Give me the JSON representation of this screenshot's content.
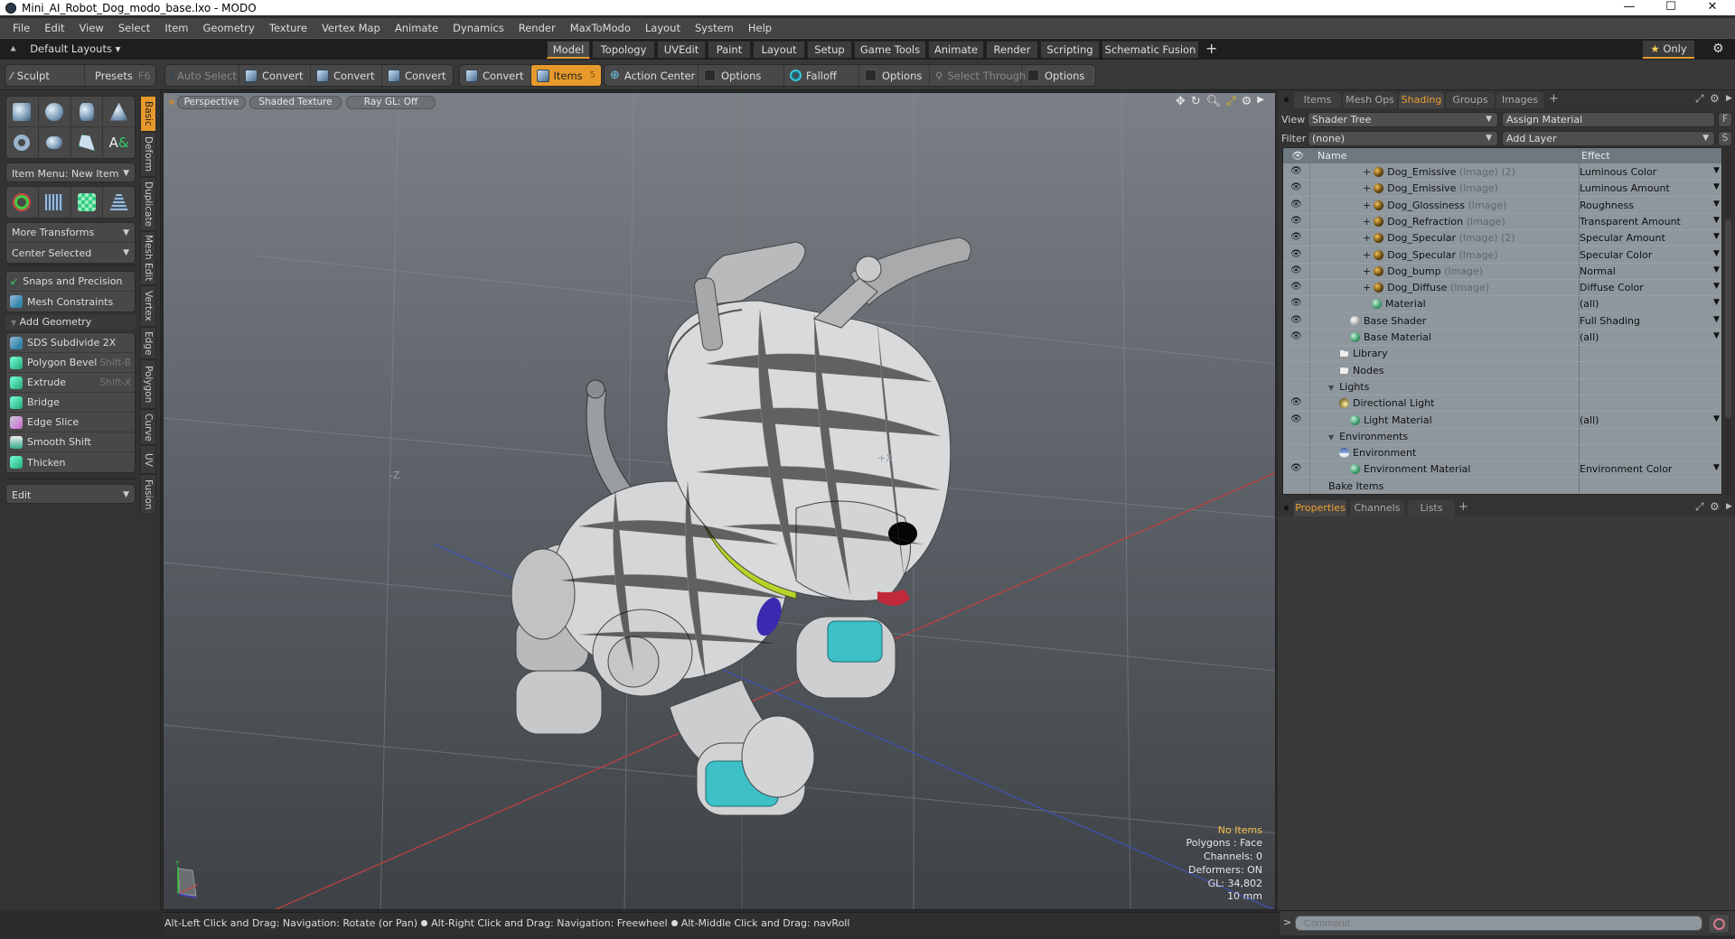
{
  "window": {
    "title": "Mini_AI_Robot_Dog_modo_base.lxo - MODO",
    "controls": {
      "minimize": "—",
      "maximize": "☐",
      "close": "✕"
    }
  },
  "menubar": [
    "File",
    "Edit",
    "View",
    "Select",
    "Item",
    "Geometry",
    "Texture",
    "Vertex Map",
    "Animate",
    "Dynamics",
    "Render",
    "MaxToModo",
    "Layout",
    "System",
    "Help"
  ],
  "layoutbar": {
    "layouts_label": "Default Layouts ▾",
    "tabs": [
      "Model",
      "Topology",
      "UVEdit",
      "Paint",
      "Layout",
      "Setup",
      "Game Tools",
      "Animate",
      "Render",
      "Scripting",
      "Schematic Fusion"
    ],
    "active_tab": "Model",
    "add_tab": "+",
    "only_label": "Only",
    "star": "★"
  },
  "toolbar": {
    "sculpt": "Sculpt",
    "presets": "Presets",
    "presets_shortcut": "F6",
    "auto_select": "Auto Select",
    "convert": "Convert",
    "items": "Items",
    "items_count": "5",
    "action_center": "Action Center",
    "options": "Options",
    "falloff": "Falloff",
    "select_through": "Select Through"
  },
  "leftpanel": {
    "item_menu": "Item Menu: New Item",
    "more_transforms": "More Transforms",
    "center_selected": "Center Selected",
    "snaps": "Snaps and Precision",
    "mesh_constraints": "Mesh Constraints",
    "add_geometry": "Add Geometry",
    "tools": [
      {
        "label": "SDS Subdivide 2X",
        "shortcut": ""
      },
      {
        "label": "Polygon Bevel",
        "shortcut": "Shift-B"
      },
      {
        "label": "Extrude",
        "shortcut": "Shift-X"
      },
      {
        "label": "Bridge",
        "shortcut": ""
      },
      {
        "label": "Edge Slice",
        "shortcut": ""
      },
      {
        "label": "Smooth Shift",
        "shortcut": ""
      },
      {
        "label": "Thicken",
        "shortcut": ""
      }
    ],
    "edit_dropdown": "Edit",
    "vertical_tabs": [
      "Basic",
      "Deform",
      "Duplicate",
      "Mesh Edit",
      "Vertex",
      "Edge",
      "Polygon",
      "Curve",
      "UV",
      "Fusion"
    ],
    "active_vertical_tab": "Basic"
  },
  "viewport": {
    "view": "Perspective",
    "shading": "Shaded Texture",
    "raygl": "Ray GL: Off",
    "hud": {
      "selection": "No Items",
      "polygons": "Polygons : Face",
      "channels": "Channels: 0",
      "deformers": "Deformers: ON",
      "gl": "GL: 34,802",
      "scale": "10 mm"
    },
    "axis_labels": {
      "y": "Y",
      "x": "X",
      "z": "Z"
    }
  },
  "rightpanel": {
    "tabs": [
      "Items",
      "Mesh Ops",
      "Shading",
      "Groups",
      "Images"
    ],
    "active_tab": "Shading",
    "add_tab": "+",
    "view_label": "View",
    "view_value": "Shader Tree",
    "assign_material": "Assign Material",
    "f_button": "F",
    "filter_label": "Filter",
    "filter_value": "(none)",
    "add_layer": "Add Layer",
    "s_button": "S",
    "tree_headers": {
      "name": "Name",
      "effect": "Effect"
    },
    "tree_rows": [
      {
        "name": "Dog_Emissive",
        "sub": "(Image) (2)",
        "effect": "Luminous Color",
        "icon": "img",
        "eye": true,
        "plus": true,
        "indent": 4
      },
      {
        "name": "Dog_Emissive",
        "sub": "(Image)",
        "effect": "Luminous Amount",
        "icon": "img",
        "eye": true,
        "plus": true,
        "indent": 4
      },
      {
        "name": "Dog_Glossiness",
        "sub": "(Image)",
        "effect": "Roughness",
        "icon": "img",
        "eye": true,
        "plus": true,
        "indent": 4
      },
      {
        "name": "Dog_Refraction",
        "sub": "(Image)",
        "effect": "Transparent Amount",
        "icon": "img",
        "eye": true,
        "plus": true,
        "indent": 4
      },
      {
        "name": "Dog_Specular",
        "sub": "(Image) (2)",
        "effect": "Specular Amount",
        "icon": "img",
        "eye": true,
        "plus": true,
        "indent": 4
      },
      {
        "name": "Dog_Specular",
        "sub": "(Image)",
        "effect": "Specular Color",
        "icon": "img",
        "eye": true,
        "plus": true,
        "indent": 4
      },
      {
        "name": "Dog_bump",
        "sub": "(Image)",
        "effect": "Normal",
        "icon": "img",
        "eye": true,
        "plus": true,
        "indent": 4
      },
      {
        "name": "Dog_Diffuse",
        "sub": "(Image)",
        "effect": "Diffuse Color",
        "icon": "img",
        "eye": true,
        "plus": true,
        "indent": 4
      },
      {
        "name": "Material",
        "sub": "",
        "effect": "(all)",
        "icon": "mat",
        "eye": true,
        "plus": false,
        "indent": 4
      },
      {
        "name": "Base Shader",
        "sub": "",
        "effect": "Full Shading",
        "icon": "white",
        "eye": true,
        "plus": false,
        "indent": 2
      },
      {
        "name": "Base Material",
        "sub": "",
        "effect": "(all)",
        "icon": "mat",
        "eye": true,
        "plus": false,
        "indent": 2
      },
      {
        "name": "Library",
        "sub": "",
        "effect": "",
        "icon": "folder",
        "eye": false,
        "plus": false,
        "indent": 1
      },
      {
        "name": "Nodes",
        "sub": "",
        "effect": "",
        "icon": "folder",
        "eye": false,
        "plus": false,
        "indent": 1
      },
      {
        "name": "Lights",
        "sub": "",
        "effect": "",
        "icon": "tri",
        "eye": false,
        "plus": false,
        "indent": 0
      },
      {
        "name": "Directional Light",
        "sub": "",
        "effect": "",
        "icon": "light",
        "eye": true,
        "plus": false,
        "indent": 1
      },
      {
        "name": "Light Material",
        "sub": "",
        "effect": "(all)",
        "icon": "mat",
        "eye": true,
        "plus": false,
        "indent": 2
      },
      {
        "name": "Environments",
        "sub": "",
        "effect": "",
        "icon": "tri",
        "eye": false,
        "plus": false,
        "indent": 0
      },
      {
        "name": "Environment",
        "sub": "",
        "effect": "",
        "icon": "env",
        "eye": false,
        "plus": false,
        "indent": 1
      },
      {
        "name": "Environment Material",
        "sub": "",
        "effect": "Environment Color",
        "icon": "mat",
        "eye": true,
        "plus": false,
        "indent": 2
      },
      {
        "name": "Bake Items",
        "sub": "",
        "effect": "",
        "icon": "none",
        "eye": false,
        "plus": false,
        "indent": 0
      }
    ],
    "props_tabs": [
      "Properties",
      "Channels",
      "Lists"
    ],
    "props_active": "Properties"
  },
  "statusbar": {
    "hint1": "Alt-Left Click and Drag: Navigation: Rotate (or Pan)",
    "hint2": "Alt-Right Click and Drag: Navigation: Freewheel",
    "hint3": "Alt-Middle Click and Drag: navRoll"
  },
  "command": {
    "prompt": ">",
    "placeholder": "Command"
  },
  "colors": {
    "accent": "#e79a2b",
    "hud_highlight": "#f5c24a",
    "shading_tab": "#f0a030"
  }
}
